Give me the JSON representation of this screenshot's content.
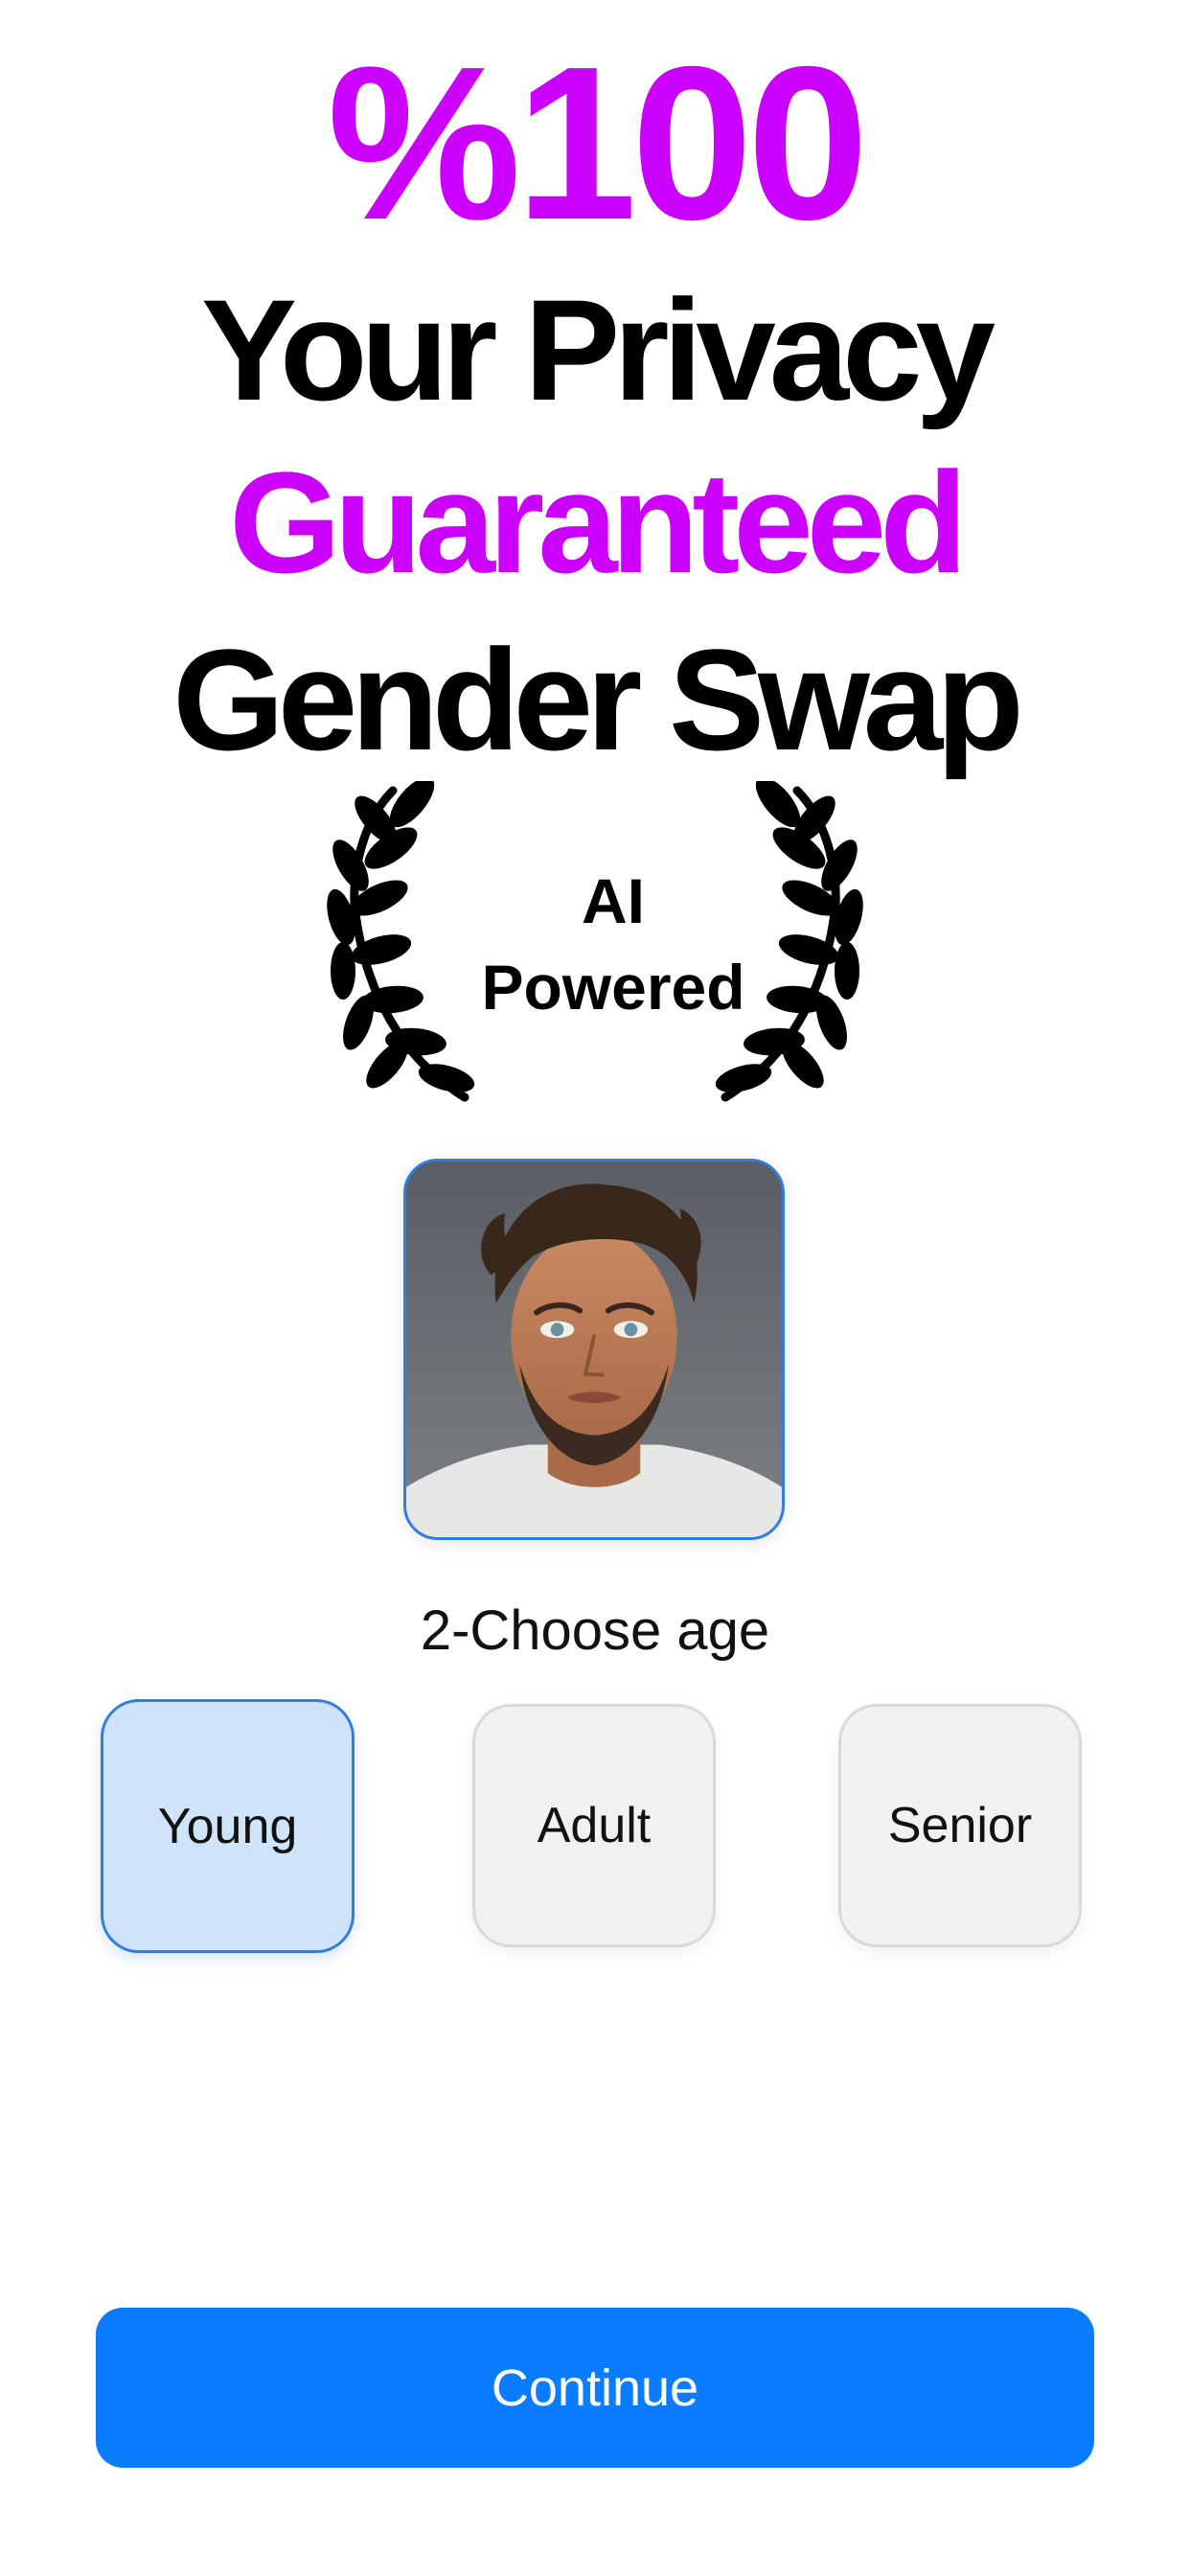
{
  "headline": {
    "percent": "%100",
    "line1": "Your Privacy",
    "line2": "Guaranteed",
    "line3": "Gender Swap"
  },
  "badge": {
    "line1": "AI",
    "line2": "Powered"
  },
  "step": {
    "label": "2-Choose age"
  },
  "age_options": [
    {
      "label": "Young",
      "selected": true
    },
    {
      "label": "Adult",
      "selected": false
    },
    {
      "label": "Senior",
      "selected": false
    }
  ],
  "continue_label": "Continue",
  "colors": {
    "accent_purple": "#cc00ff",
    "primary_blue": "#0a7cff",
    "selected_bg": "#cfe3fb",
    "selected_border": "#2f7fe0",
    "option_bg": "#f1f1f1"
  },
  "icons": {
    "laurel": "laurel-wreath-icon",
    "photo": "user-photo"
  }
}
